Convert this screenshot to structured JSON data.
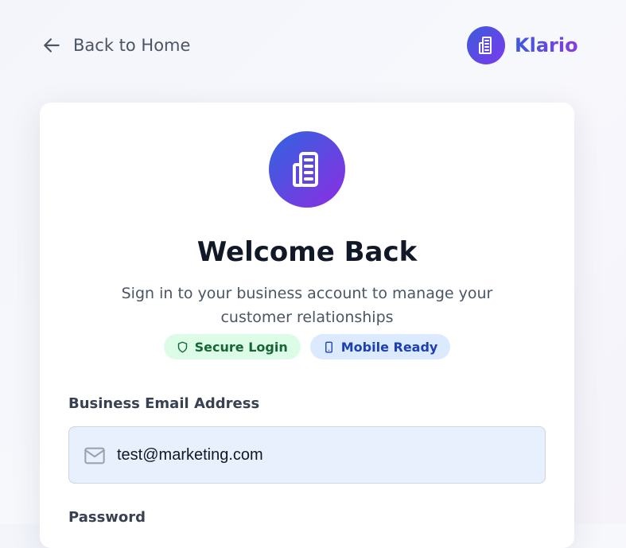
{
  "header": {
    "back_label": "Back to Home",
    "brand_name": "Klario"
  },
  "card": {
    "title": "Welcome Back",
    "subtitle": "Sign in to your business account to manage your customer relationships",
    "badges": [
      {
        "label": "Secure Login",
        "icon": "shield-icon",
        "color": "#166534"
      },
      {
        "label": "Mobile Ready",
        "icon": "smartphone-icon",
        "color": "#1e40af"
      }
    ],
    "email": {
      "label": "Business Email Address",
      "value": "test@marketing.com",
      "icon": "mail-icon"
    },
    "password": {
      "label": "Password"
    }
  },
  "colors": {
    "accent_start": "#3b5bdb",
    "accent_end": "#7c3aed"
  }
}
